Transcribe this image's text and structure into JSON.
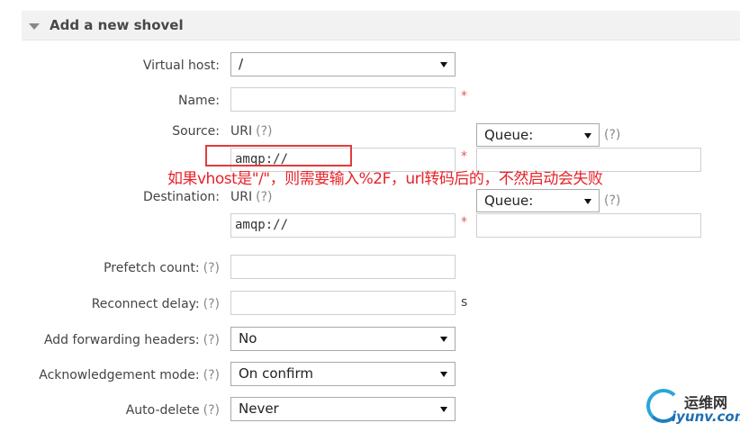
{
  "header": {
    "title": "Add a new shovel"
  },
  "fields": {
    "virtual_host": {
      "label": "Virtual host:",
      "value": "/"
    },
    "name": {
      "label": "Name:",
      "value": "",
      "required": "*"
    },
    "source": {
      "label": "Source:",
      "uri_label": "URI",
      "help": "(?)",
      "uri_value": "amqp://",
      "required": "*",
      "type_value": "Queue:",
      "queue_help": "(?)",
      "queue_value": ""
    },
    "destination": {
      "label": "Destination:",
      "uri_label": "URI",
      "help": "(?)",
      "uri_value": "amqp://",
      "required": "*",
      "type_value": "Queue:",
      "queue_help": "(?)",
      "queue_value": ""
    },
    "prefetch_count": {
      "label": "Prefetch count:",
      "help": "(?)",
      "value": ""
    },
    "reconnect_delay": {
      "label": "Reconnect delay:",
      "help": "(?)",
      "value": "",
      "unit": "s"
    },
    "add_forwarding_headers": {
      "label": "Add forwarding headers:",
      "help": "(?)",
      "value": "No"
    },
    "ack_mode": {
      "label": "Acknowledgement mode:",
      "help": "(?)",
      "value": "On confirm"
    },
    "auto_delete": {
      "label": "Auto-delete",
      "help": "(?)",
      "value": "Never"
    }
  },
  "annotation": {
    "text": "如果vhost是\"/\"，则需要输入%2F，url转码后的，不然启动会失败",
    "color": "#e6232a"
  },
  "watermark": {
    "name_cn": "运维网",
    "name_en": "iyunv.com"
  },
  "icons": {
    "collapse": "triangle-down-icon",
    "dropdown": "chevron-down-icon"
  }
}
